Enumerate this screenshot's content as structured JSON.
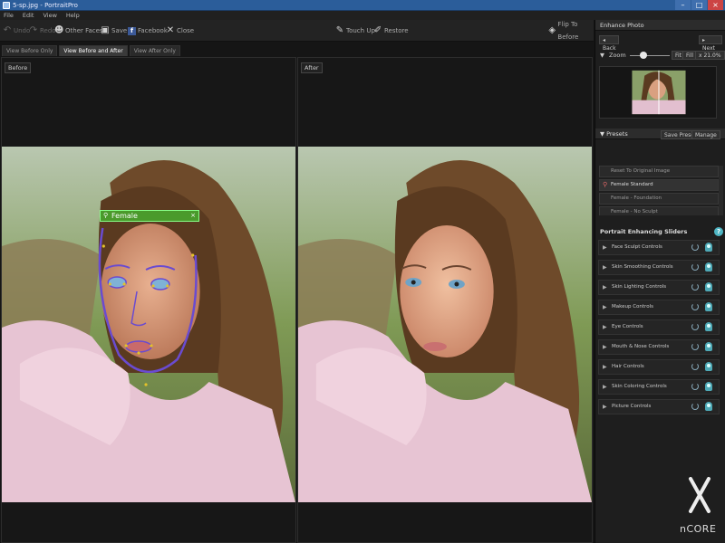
{
  "window": {
    "title": "5-sp.jpg - PortraitPro"
  },
  "menu": [
    "File",
    "Edit",
    "View",
    "Help"
  ],
  "toolbar": {
    "undo": "Undo",
    "redo": "Redo",
    "other_faces": "Other Faces",
    "save": "Save",
    "facebook": "Facebook",
    "close": "Close",
    "touch_up": "Touch Up",
    "restore": "Restore",
    "flip_to_before": "Flip To Before"
  },
  "view_tabs": [
    "View Before Only",
    "View Before and After",
    "View After Only"
  ],
  "panes": {
    "before_label": "Before",
    "after_label": "After"
  },
  "face_tag": "Female",
  "side": {
    "title": "Enhance Photo",
    "back": "Back",
    "next": "Next",
    "zoom_label": "Zoom",
    "zoom_fit": "Fit",
    "zoom_fill": "Fill",
    "zoom_value": "x 21.0%",
    "zoom_level_fraction": 0.35,
    "presets_title": "Presets",
    "save_preset": "Save Preset",
    "manage": "Manage",
    "presets": [
      "Reset To Original Image",
      "Female Standard",
      "Female - Foundation",
      "Female - No Sculpt"
    ],
    "selected_preset_index": 1,
    "sliders_title": "Portrait Enhancing Sliders",
    "controls": [
      "Face Sculpt Controls",
      "Skin Smoothing Controls",
      "Skin Lighting Controls",
      "Makeup Controls",
      "Eye Controls",
      "Mouth & Nose Controls",
      "Hair Controls",
      "Skin Coloring Controls",
      "Picture Controls"
    ],
    "logo_text": "nCORE"
  },
  "colors": {
    "accent": "#4fb6c4",
    "face_outline": "#6a4bd0",
    "tag_green": "#4a9a2b"
  }
}
